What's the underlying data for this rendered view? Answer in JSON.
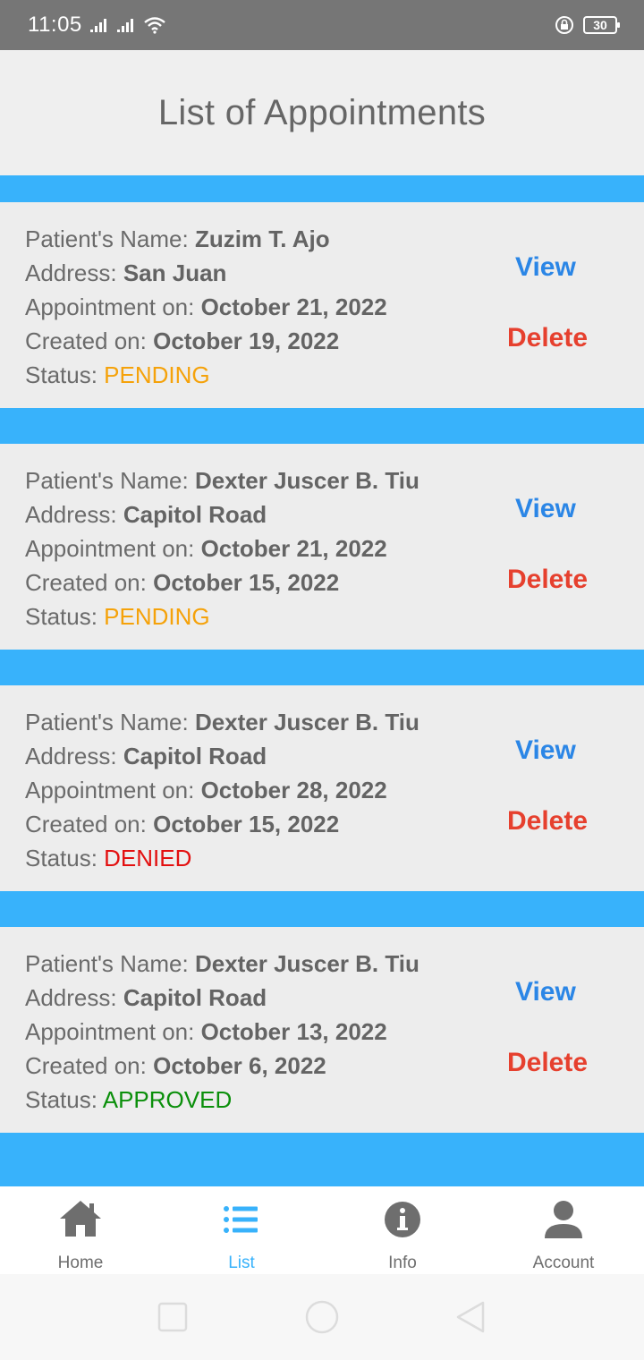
{
  "status_bar": {
    "time": "11:05",
    "battery": "30"
  },
  "header": {
    "title": "List of Appointments"
  },
  "labels": {
    "patient": "Patient's Name: ",
    "address": "Address: ",
    "appointment": "Appointment on: ",
    "created": "Created on: ",
    "status": "Status: ",
    "view": "View",
    "delete": "Delete"
  },
  "appointments": [
    {
      "patient": "Zuzim T. Ajo",
      "address": "San Juan",
      "appointment_on": "October 21, 2022",
      "created_on": "October 19, 2022",
      "status": "PENDING"
    },
    {
      "patient": "Dexter Juscer B. Tiu",
      "address": "Capitol Road",
      "appointment_on": "October 21, 2022",
      "created_on": "October 15, 2022",
      "status": "PENDING"
    },
    {
      "patient": "Dexter Juscer B. Tiu",
      "address": "Capitol Road",
      "appointment_on": "October 28, 2022",
      "created_on": "October 15, 2022",
      "status": "DENIED"
    },
    {
      "patient": "Dexter Juscer B. Tiu",
      "address": "Capitol Road",
      "appointment_on": "October 13, 2022",
      "created_on": "October 6, 2022",
      "status": "APPROVED"
    }
  ],
  "bottom_nav": [
    {
      "label": "Home",
      "icon": "home-icon",
      "active": false
    },
    {
      "label": "List",
      "icon": "list-icon",
      "active": true
    },
    {
      "label": "Info",
      "icon": "info-icon",
      "active": false
    },
    {
      "label": "Account",
      "icon": "account-icon",
      "active": false
    }
  ],
  "colors": {
    "accent": "#38b2fb",
    "view": "#2b86e6",
    "delete": "#e6402e",
    "pending": "#f5a20a",
    "denied": "#e31010",
    "approved": "#0a8f0a"
  }
}
